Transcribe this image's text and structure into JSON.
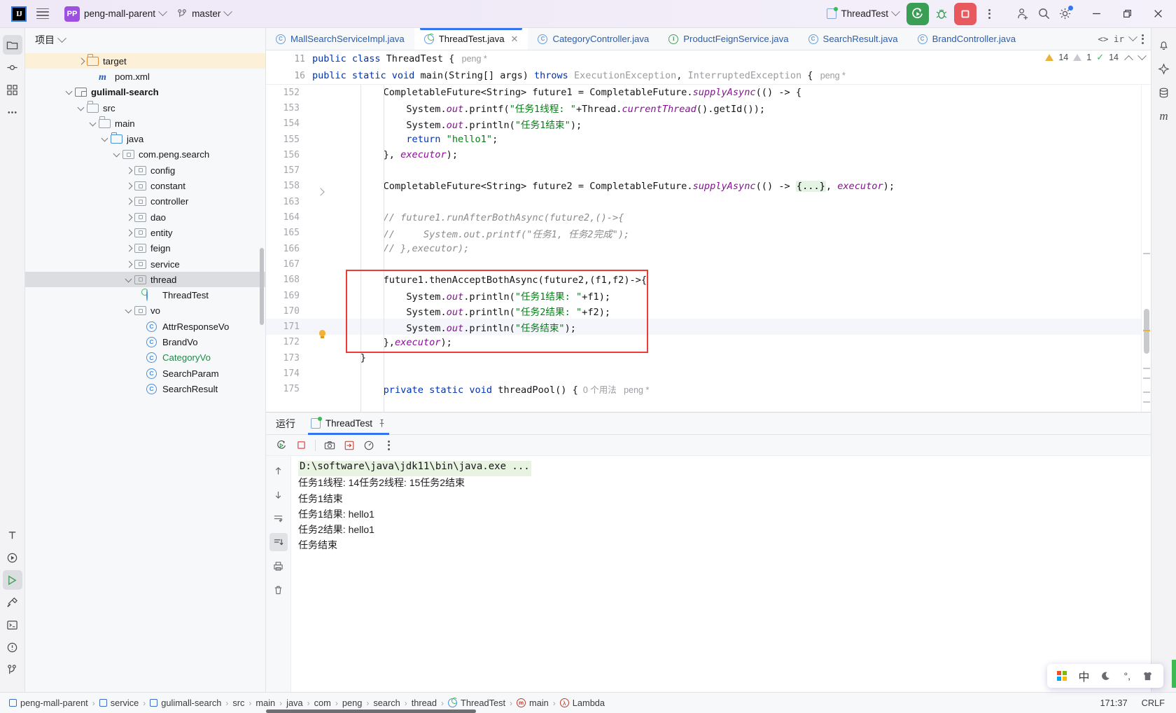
{
  "titlebar": {
    "logo": "IJ",
    "menu_icon": "hamburger-icon",
    "project_badge": "PP",
    "project_name": "peng-mall-parent",
    "branch_icon": "git-branch-icon",
    "branch_name": "master",
    "run_config": "ThreadTest",
    "run_button": "run-icon",
    "debug_button": "debug-bug-icon",
    "stop_button": "stop-square-icon",
    "more_button": "more-vertical-icon",
    "account_button": "user-add-icon",
    "search_button": "search-icon",
    "settings_button": "gear-icon",
    "minimize": "minimize-icon",
    "maximize": "restore-icon",
    "close": "close-icon"
  },
  "left_rail": {
    "items": [
      {
        "name": "project-tool-icon",
        "glyph": "folder"
      },
      {
        "name": "commit-tool-icon",
        "glyph": "commit"
      },
      {
        "name": "structure-tool-icon",
        "glyph": "structure"
      },
      {
        "name": "more-tool-icon",
        "glyph": "dots"
      }
    ],
    "bottom_items": [
      {
        "name": "terminal-icon",
        "glyph": "T"
      },
      {
        "name": "services-icon",
        "glyph": "play-circle"
      },
      {
        "name": "run-icon",
        "glyph": "run"
      },
      {
        "name": "build-icon",
        "glyph": "hammer"
      },
      {
        "name": "terminal2-icon",
        "glyph": "console"
      },
      {
        "name": "problems-icon",
        "glyph": "warn"
      },
      {
        "name": "git-icon",
        "glyph": "branch"
      }
    ]
  },
  "right_rail": {
    "items": [
      {
        "name": "notifications-icon",
        "glyph": "bell"
      },
      {
        "name": "ai-assistant-icon",
        "glyph": "ai"
      },
      {
        "name": "database-icon",
        "glyph": "db"
      },
      {
        "name": "maven-icon",
        "glyph": "m"
      }
    ]
  },
  "project_panel": {
    "title": "项目",
    "tree": [
      {
        "indent": 4,
        "arrow": "right",
        "icon": "folder-orange",
        "label": "target",
        "style": "plain",
        "selected": "orange"
      },
      {
        "indent": 5,
        "arrow": "none",
        "icon": "maven",
        "label": "pom.xml",
        "style": "plain",
        "selected": "none"
      },
      {
        "indent": 3,
        "arrow": "down",
        "icon": "module",
        "label": "gulimall-search",
        "style": "bold",
        "selected": "none"
      },
      {
        "indent": 4,
        "arrow": "down",
        "icon": "folder",
        "label": "src",
        "style": "plain",
        "selected": "none"
      },
      {
        "indent": 5,
        "arrow": "down",
        "icon": "folder",
        "label": "main",
        "style": "plain",
        "selected": "none"
      },
      {
        "indent": 6,
        "arrow": "down",
        "icon": "folder-blue",
        "label": "java",
        "style": "plain",
        "selected": "none"
      },
      {
        "indent": 7,
        "arrow": "down",
        "icon": "package",
        "label": "com.peng.search",
        "style": "plain",
        "selected": "none"
      },
      {
        "indent": 8,
        "arrow": "right",
        "icon": "package",
        "label": "config",
        "style": "plain",
        "selected": "none"
      },
      {
        "indent": 8,
        "arrow": "right",
        "icon": "package",
        "label": "constant",
        "style": "plain",
        "selected": "none"
      },
      {
        "indent": 8,
        "arrow": "right",
        "icon": "package",
        "label": "controller",
        "style": "plain",
        "selected": "none"
      },
      {
        "indent": 8,
        "arrow": "right",
        "icon": "package",
        "label": "dao",
        "style": "plain",
        "selected": "none"
      },
      {
        "indent": 8,
        "arrow": "right",
        "icon": "package",
        "label": "entity",
        "style": "plain",
        "selected": "none"
      },
      {
        "indent": 8,
        "arrow": "right",
        "icon": "package",
        "label": "feign",
        "style": "plain",
        "selected": "none"
      },
      {
        "indent": 8,
        "arrow": "right",
        "icon": "package",
        "label": "service",
        "style": "plain",
        "selected": "none"
      },
      {
        "indent": 8,
        "arrow": "down",
        "icon": "package",
        "label": "thread",
        "style": "plain",
        "selected": "grey"
      },
      {
        "indent": 9,
        "arrow": "none",
        "icon": "runclass",
        "label": "ThreadTest",
        "style": "plain",
        "selected": "none"
      },
      {
        "indent": 8,
        "arrow": "down",
        "icon": "package",
        "label": "vo",
        "style": "plain",
        "selected": "none"
      },
      {
        "indent": 9,
        "arrow": "none",
        "icon": "class",
        "label": "AttrResponseVo",
        "style": "plain",
        "selected": "none"
      },
      {
        "indent": 9,
        "arrow": "none",
        "icon": "class",
        "label": "BrandVo",
        "style": "plain",
        "selected": "none"
      },
      {
        "indent": 9,
        "arrow": "none",
        "icon": "class",
        "label": "CategoryVo",
        "style": "green",
        "selected": "none"
      },
      {
        "indent": 9,
        "arrow": "none",
        "icon": "class",
        "label": "SearchParam",
        "style": "plain",
        "selected": "none"
      },
      {
        "indent": 9,
        "arrow": "none",
        "icon": "class",
        "label": "SearchResult",
        "style": "plain",
        "selected": "none"
      }
    ]
  },
  "editor": {
    "tabs": [
      {
        "label": "MallSearchServiceImpl.java",
        "icon": "class-c-icon",
        "active": false,
        "closable": false
      },
      {
        "label": "ThreadTest.java",
        "icon": "runnable-class-icon",
        "active": true,
        "closable": true
      },
      {
        "label": "CategoryController.java",
        "icon": "class-c-icon",
        "active": false,
        "closable": false
      },
      {
        "label": "ProductFeignService.java",
        "icon": "interface-i-icon",
        "active": false,
        "closable": false
      },
      {
        "label": "SearchResult.java",
        "icon": "class-c-icon",
        "active": false,
        "closable": false
      },
      {
        "label": "BrandController.java",
        "icon": "class-c-icon",
        "active": false,
        "closable": false
      }
    ],
    "tabbar_right": {
      "code_nav": "<> ir",
      "chevron": "chevron-down-icon",
      "more": "more-vertical-icon"
    },
    "sticky_lines": [
      {
        "num": "11",
        "html": "kw:public |kw:class |typ:ThreadTest| pl:{|hint:  ▲ peng *"
      },
      {
        "num": "16",
        "html": "    kw:public kw:static kw:void typ:main(typ:String[] pl:args) kw:throws grey:ExecutionException, InterruptedException pl:{ hint:▲ peng *"
      }
    ],
    "inspection": {
      "warnings": "14",
      "weak_warnings": "1",
      "checks": "14"
    },
    "lines": [
      {
        "num": "152",
        "mark": "none",
        "hl": false
      },
      {
        "num": "153",
        "mark": "none",
        "hl": false
      },
      {
        "num": "154",
        "mark": "none",
        "hl": false
      },
      {
        "num": "155",
        "mark": "none",
        "hl": false
      },
      {
        "num": "156",
        "mark": "none",
        "hl": false
      },
      {
        "num": "157",
        "mark": "none",
        "hl": false
      },
      {
        "num": "158",
        "mark": "fold",
        "hl": false
      },
      {
        "num": "163",
        "mark": "none",
        "hl": false
      },
      {
        "num": "164",
        "mark": "none",
        "hl": false
      },
      {
        "num": "165",
        "mark": "none",
        "hl": false
      },
      {
        "num": "166",
        "mark": "none",
        "hl": false
      },
      {
        "num": "167",
        "mark": "none",
        "hl": false
      },
      {
        "num": "168",
        "mark": "none",
        "hl": false
      },
      {
        "num": "169",
        "mark": "none",
        "hl": false
      },
      {
        "num": "170",
        "mark": "none",
        "hl": false
      },
      {
        "num": "171",
        "mark": "bulb",
        "hl": true
      },
      {
        "num": "172",
        "mark": "none",
        "hl": false
      },
      {
        "num": "173",
        "mark": "none",
        "hl": false
      },
      {
        "num": "174",
        "mark": "none",
        "hl": false
      },
      {
        "num": "175",
        "mark": "none",
        "hl": false
      }
    ],
    "code_text": {
      "l152": "CompletableFuture<String> future1 = CompletableFuture.supplyAsync(() -> {",
      "l153": "System.out.printf(\"任务1线程: \"+Thread.currentThread().getId());",
      "l154": "System.out.println(\"任务1结束\");",
      "l155": "return \"hello1\";",
      "l156": "}, executor);",
      "l157": "",
      "l158": "CompletableFuture<String> future2 = CompletableFuture.supplyAsync(() -> {...}, executor);",
      "l163": "",
      "l164": "// future1.runAfterBothAsync(future2,()->{",
      "l165": "//     System.out.printf(\"任务1, 任务2完成\");",
      "l166": "// },executor);",
      "l167": "",
      "l168": "future1.thenAcceptBothAsync(future2,(f1,f2)->{",
      "l169": "System.out.println(\"任务1结果: \"+f1);",
      "l170": "System.out.println(\"任务2结果: \"+f2);",
      "l171": "System.out.println(\"任务结束\");",
      "l172": "},executor);",
      "l173": "}",
      "l174": "",
      "l175": "private static void threadPool() {  0 个用法  ▲ peng *"
    },
    "annotation_box": {
      "name": "red-highlight-rectangle",
      "color": "#ef3b36"
    }
  },
  "run_panel": {
    "title": "运行",
    "tab_label": "ThreadTest",
    "tab_icon": "run-config-icon",
    "pin_icon": "pin-icon",
    "toolbar": [
      {
        "name": "rerun-button",
        "glyph": "rerun"
      },
      {
        "name": "stop-button",
        "glyph": "stop"
      },
      {
        "name": "screenshot-button",
        "glyph": "camera"
      },
      {
        "name": "export-button",
        "glyph": "export"
      },
      {
        "name": "profiler-button",
        "glyph": "gauge"
      },
      {
        "name": "more-button",
        "glyph": "dots"
      }
    ],
    "side_toolbar": [
      {
        "name": "scroll-up-button",
        "glyph": "up"
      },
      {
        "name": "scroll-down-button",
        "glyph": "down"
      },
      {
        "name": "soft-wrap-button",
        "glyph": "wrap"
      },
      {
        "name": "scroll-to-end-button",
        "glyph": "end",
        "active": true
      },
      {
        "name": "print-button",
        "glyph": "print"
      },
      {
        "name": "clear-all-button",
        "glyph": "trash"
      }
    ],
    "console": [
      {
        "text": "D:\\software\\java\\jdk11\\bin\\java.exe ...",
        "style": "cmd"
      },
      {
        "text": "任务1线程: 14任务2线程: 15任务2结束",
        "style": "normal"
      },
      {
        "text": "任务1结束",
        "style": "normal"
      },
      {
        "text": "任务1结果: hello1",
        "style": "normal"
      },
      {
        "text": "任务2结果: hello1",
        "style": "normal"
      },
      {
        "text": "任务结束",
        "style": "normal"
      }
    ]
  },
  "status_bar": {
    "breadcrumbs": [
      {
        "label": "peng-mall-parent",
        "icon": "module-icon"
      },
      {
        "label": "service",
        "icon": "module-icon"
      },
      {
        "label": "gulimall-search",
        "icon": "module-icon"
      },
      {
        "label": "src",
        "icon": "none"
      },
      {
        "label": "main",
        "icon": "none"
      },
      {
        "label": "java",
        "icon": "none"
      },
      {
        "label": "com",
        "icon": "none"
      },
      {
        "label": "peng",
        "icon": "none"
      },
      {
        "label": "search",
        "icon": "none"
      },
      {
        "label": "thread",
        "icon": "none"
      },
      {
        "label": "ThreadTest",
        "icon": "runnable-class-icon"
      },
      {
        "label": "main",
        "icon": "method-icon"
      },
      {
        "label": "Lambda",
        "icon": "lambda-icon"
      }
    ],
    "separator": "›",
    "caret_position": "171:37",
    "line_separator": "CRLF"
  },
  "ime_bar": {
    "windows_icon": "windows-logo-icon",
    "mode": "中",
    "moon_icon": "moon-icon",
    "punctuation_icon": "°,",
    "skin_icon": "skin-icon"
  }
}
